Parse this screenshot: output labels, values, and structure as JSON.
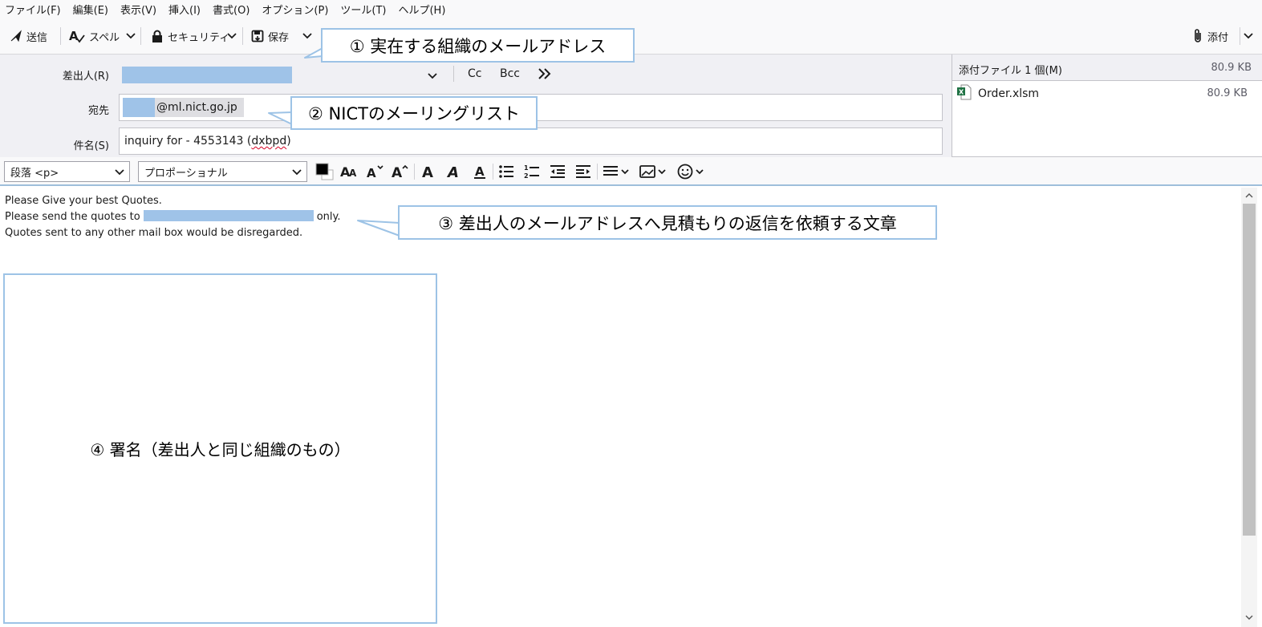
{
  "menu": {
    "items": [
      "ファイル(F)",
      "編集(E)",
      "表示(V)",
      "挿入(I)",
      "書式(O)",
      "オプション(P)",
      "ツール(T)",
      "ヘルプ(H)"
    ]
  },
  "toolbar": {
    "send_label": "送信",
    "spell_label": "スペル",
    "security_label": "セキュリティ",
    "save_label": "保存",
    "attach_label": "添付"
  },
  "header": {
    "from_label": "差出人(R)",
    "to_label": "宛先",
    "subject_label": "件名(S)",
    "cc_label": "Cc",
    "bcc_label": "Bcc",
    "to_domain": "@ml.nict.go.jp",
    "subject_prefix": "inquiry for - 4553143 (",
    "subject_spell": "dxbpd",
    "subject_suffix": ")"
  },
  "attachments": {
    "title": "添付ファイル 1 個(M)",
    "total_size": "80.9 KB",
    "items": [
      {
        "name": "Order.xlsm",
        "size": "80.9 KB",
        "icon": "excel-file-icon"
      }
    ]
  },
  "format": {
    "paragraph_value": "段落 <p>",
    "font_value": "プロポーショナル"
  },
  "body": {
    "line1": "Please Give your best Quotes.",
    "line2_prefix": "Please send the quotes to",
    "line2_suffix": "only.",
    "line3": "Quotes sent to any other mail box would be disregarded."
  },
  "annotations": {
    "callout1": "① 実在する組織のメールアドレス",
    "callout2": "② NICTのメーリングリスト",
    "callout3": "③ 差出人のメールアドレスへ見積もりの返信を依頼する文章",
    "callout4": "④ 署名（差出人と同じ組織のもの）"
  },
  "colors": {
    "redaction": "#9fc3e8",
    "callout_border": "#9dc3e6",
    "header_bg": "#f0f0f4"
  }
}
